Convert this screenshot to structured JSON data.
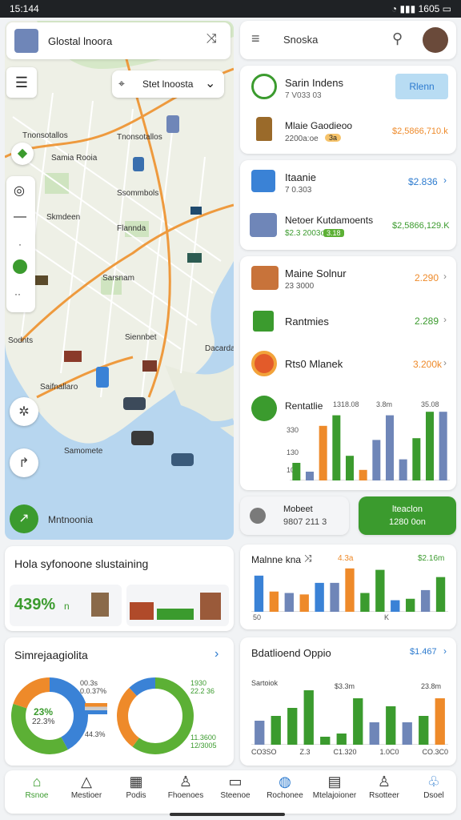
{
  "status": {
    "time": "15:144",
    "right": "1605"
  },
  "map_header": {
    "title": "Glostal lnoora",
    "close_icon": "shuffle-icon"
  },
  "map_filter": {
    "label": "Stet lnoosta"
  },
  "map_labels": [
    "Tnonsotallos",
    "Samia Rooia",
    "Ssommbols",
    "Skmdeen",
    "Flannda",
    "Sarsnam",
    "Siennbet",
    "Sodnts",
    "Dacarda",
    "Saifnallaro",
    "Samomete"
  ],
  "map_footer": {
    "label": "Mntnoonia"
  },
  "search": {
    "placeholder": "Snoska"
  },
  "top_card": {
    "title": "Sarin Indens",
    "subtitle": "7 V033 03",
    "button": "Rlenn",
    "item_title": "Mlaie Gaodieoo",
    "item_sub": "2200a:oe",
    "item_badge": "3a",
    "item_value": "$2,5866,710.k"
  },
  "card2": {
    "rows": [
      {
        "title": "Itaanie",
        "sub": "7 0.303",
        "value": "$2.836"
      },
      {
        "title": "Netoer Kutdamoents",
        "sub": "$2.3 2003o",
        "badge": "3.18",
        "value": "$2,5866,129.K"
      }
    ]
  },
  "card3": {
    "rows": [
      {
        "title": "Maine Solnur",
        "sub": "23 3000",
        "value": "2.290"
      },
      {
        "title": "Rantmies",
        "value": "2.289"
      },
      {
        "title": "Rts0 Mlanek",
        "value": "3.200k"
      },
      {
        "title": "Rentatlie",
        "c1": "1318.08",
        "c2": "3.8m",
        "c3": "35.08"
      }
    ],
    "axis": [
      "330",
      "130",
      "10"
    ]
  },
  "mini_chart1": {
    "bars": [
      {
        "v": 20,
        "c": "#3b9b2e"
      },
      {
        "v": 10,
        "c": "#6f86b8"
      },
      {
        "v": 62,
        "c": "#ee8a2a"
      },
      {
        "v": 74,
        "c": "#3b9b2e"
      },
      {
        "v": 28,
        "c": "#3b9b2e"
      },
      {
        "v": 12,
        "c": "#ee8a2a"
      },
      {
        "v": 46,
        "c": "#6f86b8"
      },
      {
        "v": 74,
        "c": "#6f86b8"
      },
      {
        "v": 24,
        "c": "#6f86b8"
      },
      {
        "v": 48,
        "c": "#3b9b2e"
      },
      {
        "v": 78,
        "c": "#3b9b2e"
      },
      {
        "v": 78,
        "c": "#6f86b8"
      }
    ]
  },
  "buttons": {
    "left_title": "Mobeet",
    "left_sub": "9807 211 3",
    "right_title": "lteaclon",
    "right_sub": "1280 0on"
  },
  "left_bottom": {
    "title": "Hola syfonoone slustaining",
    "value": "439%",
    "suffix": "n"
  },
  "donut_card": {
    "title": "Simrejaagiolita",
    "d1_center": "23%",
    "d1_sub": "22.3%",
    "labels": [
      "00.3s",
      "0.0.37%",
      "44.3%",
      "1930",
      "22.2 36",
      "11.3600",
      "12/3005"
    ],
    "d1": [
      {
        "v": 0.42,
        "c": "#3a82d6"
      },
      {
        "v": 0.38,
        "c": "#5cb035"
      },
      {
        "v": 0.2,
        "c": "#ee8a2a"
      }
    ],
    "d2": [
      {
        "v": 0.6,
        "c": "#5cb035"
      },
      {
        "v": 0.28,
        "c": "#ee8a2a"
      },
      {
        "v": 0.12,
        "c": "#3a82d6"
      }
    ]
  },
  "chart2": {
    "title": "Malnne kna",
    "label1": "4.3a",
    "value": "$2.16m",
    "x_left": "50",
    "x_mid": "K",
    "bars": [
      {
        "v": 50,
        "c": "#3a82d6"
      },
      {
        "v": 28,
        "c": "#ee8a2a"
      },
      {
        "v": 26,
        "c": "#6f86b8"
      },
      {
        "v": 24,
        "c": "#ee8a2a"
      },
      {
        "v": 40,
        "c": "#3a82d6"
      },
      {
        "v": 40,
        "c": "#6f86b8"
      },
      {
        "v": 60,
        "c": "#ee8a2a"
      },
      {
        "v": 26,
        "c": "#3b9b2e"
      },
      {
        "v": 58,
        "c": "#3b9b2e"
      },
      {
        "v": 16,
        "c": "#3a82d6"
      },
      {
        "v": 18,
        "c": "#3b9b2e"
      },
      {
        "v": 30,
        "c": "#6f86b8"
      },
      {
        "v": 48,
        "c": "#3b9b2e"
      }
    ]
  },
  "chart3": {
    "title": "Bdatlioend Oppio",
    "value": "$1.467",
    "labels_top": [
      "Sartoiok",
      "$3.3m",
      "23.8m"
    ],
    "labels_bottom": [
      "CO3SO",
      "Z.3",
      "C1.320",
      "1.0C0",
      "CO.3C0"
    ],
    "bars": [
      {
        "v": 30,
        "c": "#6f86b8"
      },
      {
        "v": 36,
        "c": "#3b9b2e"
      },
      {
        "v": 46,
        "c": "#3b9b2e"
      },
      {
        "v": 68,
        "c": "#3b9b2e"
      },
      {
        "v": 10,
        "c": "#3b9b2e"
      },
      {
        "v": 14,
        "c": "#3b9b2e"
      },
      {
        "v": 58,
        "c": "#3b9b2e"
      },
      {
        "v": 28,
        "c": "#6f86b8"
      },
      {
        "v": 48,
        "c": "#3b9b2e"
      },
      {
        "v": 28,
        "c": "#6f86b8"
      },
      {
        "v": 36,
        "c": "#3b9b2e"
      },
      {
        "v": 58,
        "c": "#ee8a2a"
      }
    ]
  },
  "nav": [
    {
      "label": "Rsnoe",
      "icon": "home-icon",
      "glyph": "⌂",
      "color": "#3b9b2e"
    },
    {
      "label": "Mestioer",
      "icon": "triangle-icon",
      "glyph": "△",
      "color": "#333"
    },
    {
      "label": "Podis",
      "icon": "grid-icon",
      "glyph": "▦",
      "color": "#333"
    },
    {
      "label": "Fhoenoes",
      "icon": "user-icon",
      "glyph": "♙",
      "color": "#333"
    },
    {
      "label": "Steenoe",
      "icon": "box-icon",
      "glyph": "▭",
      "color": "#333"
    },
    {
      "label": "Rochonee",
      "icon": "globe-icon",
      "glyph": "◍",
      "color": "#2d7bcf"
    },
    {
      "label": "Mtelajoioner",
      "icon": "book-icon",
      "glyph": "▤",
      "color": "#333"
    },
    {
      "label": "Rsotteer",
      "icon": "person-icon",
      "glyph": "♙",
      "color": "#333"
    },
    {
      "label": "Dsoel",
      "icon": "club-icon",
      "glyph": "♧",
      "color": "#2d7bcf"
    }
  ]
}
